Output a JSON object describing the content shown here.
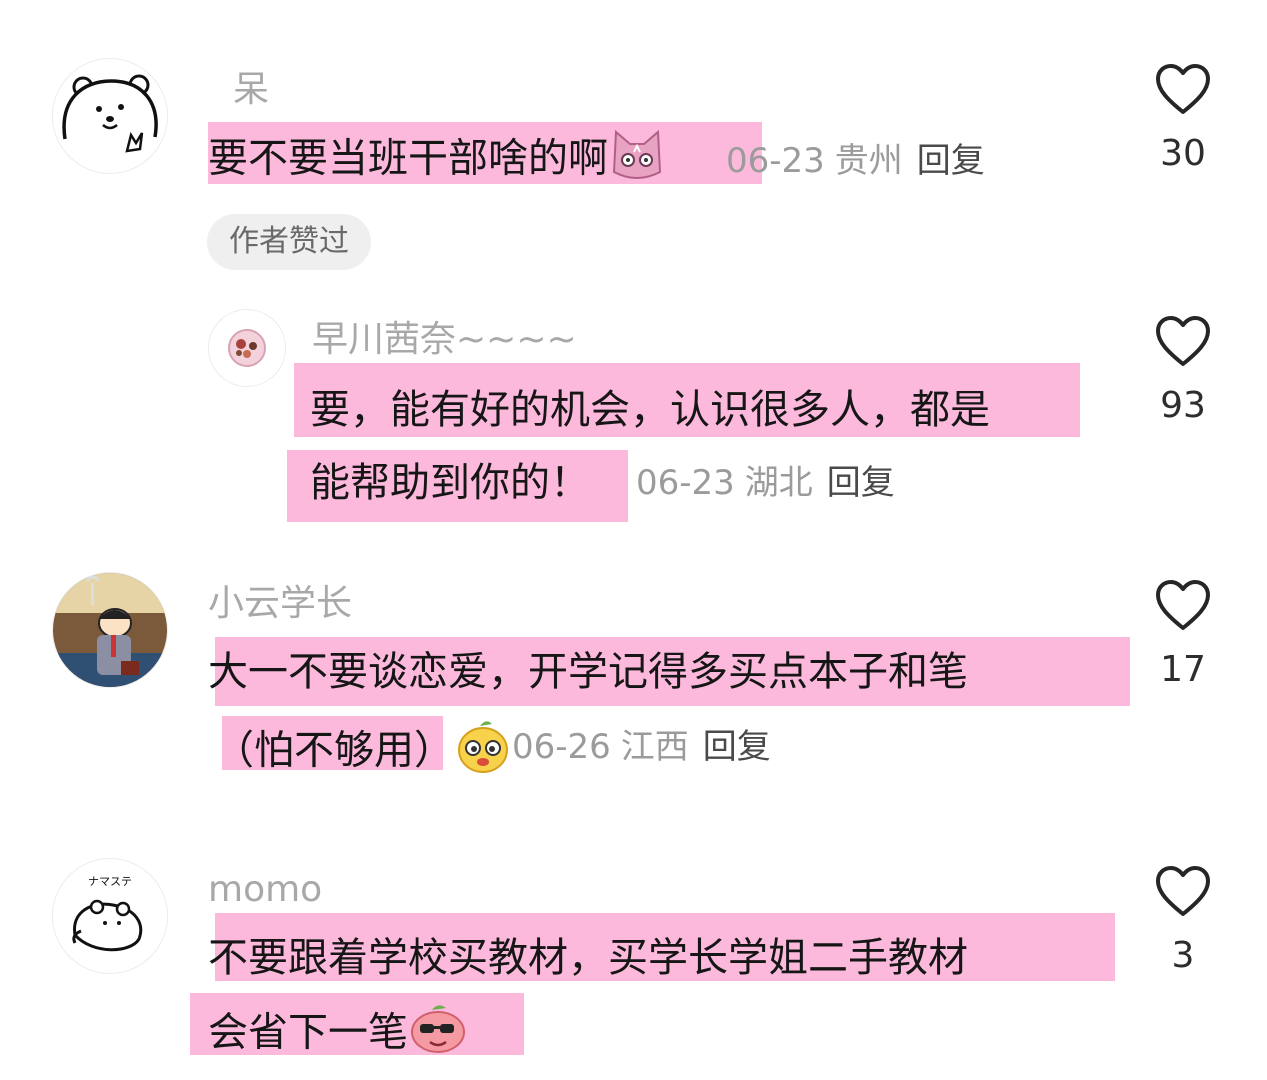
{
  "comments": [
    {
      "username": "呆",
      "text": "要不要当班干部啥的啊",
      "emoji_icon": "cat-face-emoji",
      "date": "06-23",
      "location": "贵州",
      "reply_label": "回复",
      "like_count": "30",
      "badge": "作者赞过",
      "avatar_icon": "white-bear-avatar"
    },
    {
      "username": "早川茜奈~~~~",
      "text_line1": "要，能有好的机会，认识很多人，都是",
      "text_line2": "能帮助到你的！",
      "date": "06-23",
      "location": "湖北",
      "reply_label": "回复",
      "like_count": "93",
      "avatar_icon": "food-plate-avatar"
    },
    {
      "username": "小云学长",
      "text_line1": "大一不要谈恋爱，开学记得多买点本子和笔",
      "text_line2": "（怕不够用）",
      "emoji_icon": "yellow-dog-emoji",
      "date": "06-26",
      "location": "江西",
      "reply_label": "回复",
      "like_count": "17",
      "avatar_icon": "cartoon-boy-avatar"
    },
    {
      "username": "momo",
      "text_line1": "不要跟着学校买教材，买学长学姐二手教材",
      "text_line2": "会省下一笔",
      "emoji_icon": "pink-sunglasses-emoji",
      "like_count": "3",
      "avatar_icon": "lying-bear-avatar",
      "avatar_text": "ナマステ"
    }
  ],
  "colors": {
    "highlight": "#fcb9dc",
    "meta": "#9b9b9b",
    "username": "#a8a8a8"
  }
}
